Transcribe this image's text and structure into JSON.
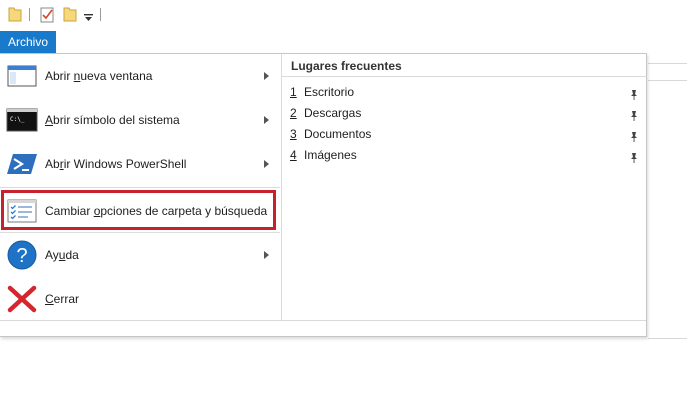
{
  "toolbar": {
    "icons": [
      "folder-icon",
      "properties-icon",
      "new-folder-icon",
      "customize-dropdown-icon"
    ]
  },
  "file_tab": {
    "label": "Archivo"
  },
  "menu": {
    "items": [
      {
        "name": "open-new-window",
        "pre": "Abrir ",
        "ul": "n",
        "post": "ueva ventana",
        "has_submenu": true,
        "icon": "new-window-icon"
      },
      {
        "name": "open-command-prompt",
        "pre": "",
        "ul": "A",
        "post": "brir símbolo del sistema",
        "has_submenu": true,
        "icon": "command-prompt-icon"
      },
      {
        "name": "open-powershell",
        "pre": "Ab",
        "ul": "r",
        "post": "ir Windows PowerShell",
        "has_submenu": true,
        "icon": "powershell-icon"
      },
      {
        "name": "change-folder-options",
        "pre": "Cambiar ",
        "ul": "o",
        "post": "pciones de carpeta y búsqueda",
        "has_submenu": false,
        "icon": "folder-options-icon",
        "highlighted": true
      },
      {
        "name": "help",
        "pre": "Ay",
        "ul": "u",
        "post": "da",
        "has_submenu": true,
        "icon": "help-icon"
      },
      {
        "name": "close",
        "pre": "",
        "ul": "C",
        "post": "errar",
        "has_submenu": false,
        "icon": "close-icon"
      }
    ]
  },
  "frequent": {
    "title": "Lugares frecuentes",
    "places": [
      {
        "num": "1",
        "name": "Escritorio"
      },
      {
        "num": "2",
        "name": "Descargas"
      },
      {
        "num": "3",
        "name": "Documentos"
      },
      {
        "num": "4",
        "name": "Imágenes"
      }
    ]
  },
  "colors": {
    "accent": "#1979ca",
    "highlight_border": "#c4232d"
  }
}
